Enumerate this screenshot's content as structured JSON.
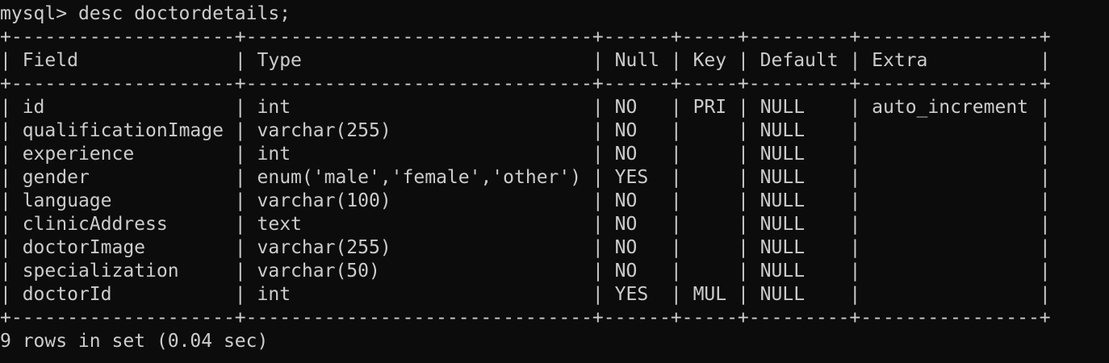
{
  "terminal": {
    "prompt": "mysql> ",
    "command": "desc doctordetails;",
    "columns": [
      "Field",
      "Type",
      "Null",
      "Key",
      "Default",
      "Extra"
    ],
    "rows": [
      [
        "id",
        "int",
        "NO",
        "PRI",
        "NULL",
        "auto_increment"
      ],
      [
        "qualificationImage",
        "varchar(255)",
        "NO",
        "",
        "NULL",
        ""
      ],
      [
        "experience",
        "int",
        "NO",
        "",
        "NULL",
        ""
      ],
      [
        "gender",
        "enum('male','female','other')",
        "YES",
        "",
        "NULL",
        ""
      ],
      [
        "language",
        "varchar(100)",
        "NO",
        "",
        "NULL",
        ""
      ],
      [
        "clinicAddress",
        "text",
        "NO",
        "",
        "NULL",
        ""
      ],
      [
        "doctorImage",
        "varchar(255)",
        "NO",
        "",
        "NULL",
        ""
      ],
      [
        "specialization",
        "varchar(50)",
        "NO",
        "",
        "NULL",
        ""
      ],
      [
        "doctorId",
        "int",
        "YES",
        "MUL",
        "NULL",
        ""
      ]
    ],
    "footer": "9 rows in set (0.04 sec)"
  }
}
